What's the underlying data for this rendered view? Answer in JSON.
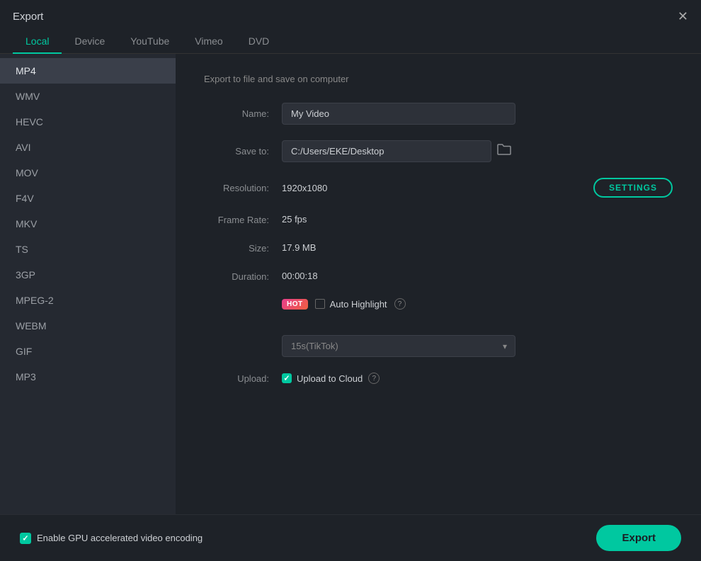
{
  "window": {
    "title": "Export"
  },
  "tabs": [
    {
      "id": "local",
      "label": "Local",
      "active": true
    },
    {
      "id": "device",
      "label": "Device",
      "active": false
    },
    {
      "id": "youtube",
      "label": "YouTube",
      "active": false
    },
    {
      "id": "vimeo",
      "label": "Vimeo",
      "active": false
    },
    {
      "id": "dvd",
      "label": "DVD",
      "active": false
    }
  ],
  "sidebar": {
    "items": [
      {
        "id": "mp4",
        "label": "MP4",
        "active": true
      },
      {
        "id": "wmv",
        "label": "WMV",
        "active": false
      },
      {
        "id": "hevc",
        "label": "HEVC",
        "active": false
      },
      {
        "id": "avi",
        "label": "AVI",
        "active": false
      },
      {
        "id": "mov",
        "label": "MOV",
        "active": false
      },
      {
        "id": "f4v",
        "label": "F4V",
        "active": false
      },
      {
        "id": "mkv",
        "label": "MKV",
        "active": false
      },
      {
        "id": "ts",
        "label": "TS",
        "active": false
      },
      {
        "id": "3gp",
        "label": "3GP",
        "active": false
      },
      {
        "id": "mpeg2",
        "label": "MPEG-2",
        "active": false
      },
      {
        "id": "webm",
        "label": "WEBM",
        "active": false
      },
      {
        "id": "gif",
        "label": "GIF",
        "active": false
      },
      {
        "id": "mp3",
        "label": "MP3",
        "active": false
      }
    ]
  },
  "content": {
    "section_title": "Export to file and save on computer",
    "fields": {
      "name_label": "Name:",
      "name_value": "My Video",
      "save_to_label": "Save to:",
      "save_to_value": "C:/Users/EKE/Desktop",
      "resolution_label": "Resolution:",
      "resolution_value": "1920x1080",
      "settings_button": "SETTINGS",
      "frame_rate_label": "Frame Rate:",
      "frame_rate_value": "25 fps",
      "size_label": "Size:",
      "size_value": "17.9 MB",
      "duration_label": "Duration:",
      "duration_value": "00:00:18",
      "hot_badge": "HOT",
      "auto_highlight_label": "Auto Highlight",
      "dropdown_value": "15s(TikTok)",
      "upload_label": "Upload:",
      "upload_to_cloud_label": "Upload to Cloud"
    }
  },
  "bottom": {
    "gpu_label": "Enable GPU accelerated video encoding",
    "export_button": "Export"
  }
}
